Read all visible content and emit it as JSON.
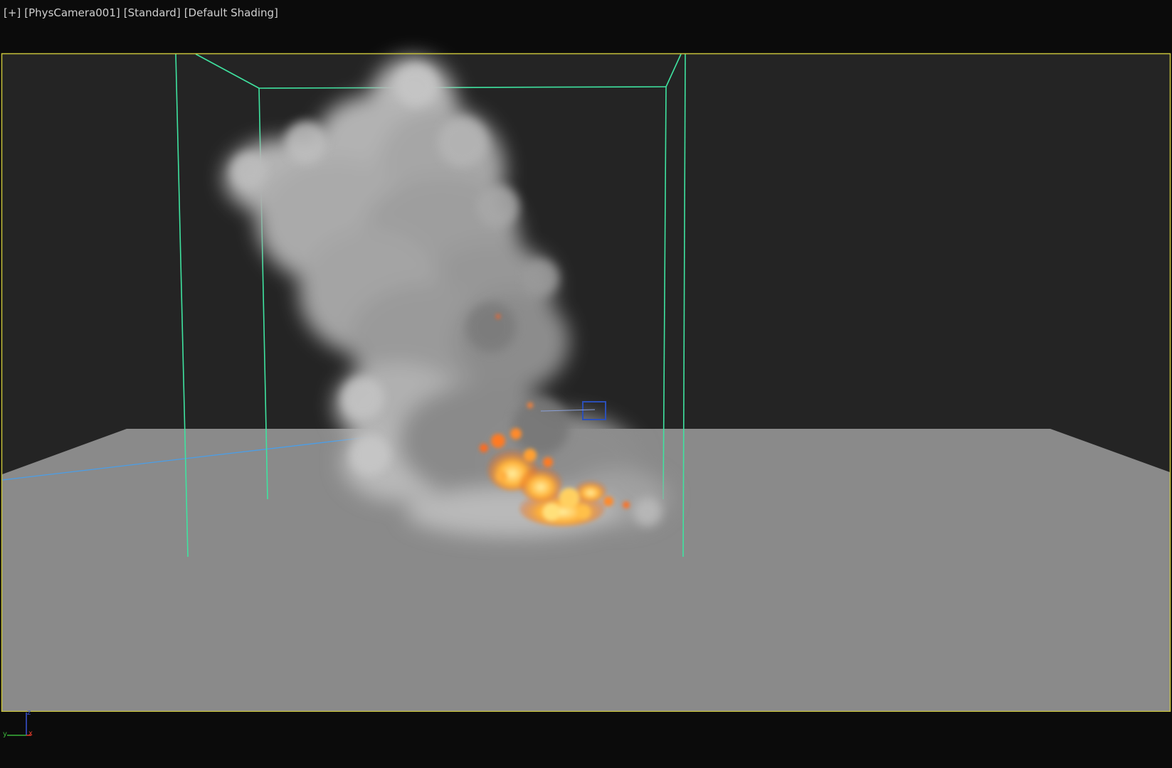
{
  "viewport": {
    "labels": [
      "[+]",
      "[PhysCamera001]",
      "[Standard]",
      "[Default Shading]"
    ],
    "active_border_color": "#c7c23a"
  },
  "scene": {
    "background_color": "#242424",
    "ground_color": "#8a8a8a",
    "bounding_box_color": "#3fe3a0",
    "camera_line_color": "#4a9ee8",
    "smoke_color": "#a9a9a9",
    "fire_colors": [
      "#ff6a1a",
      "#ffb640",
      "#ffe27a"
    ]
  },
  "axis_gizmo": {
    "z": "z",
    "y": "y",
    "x": "x",
    "colors": {
      "x": "#e03a2a",
      "y": "#3bb33b",
      "z": "#3a55d8"
    }
  }
}
